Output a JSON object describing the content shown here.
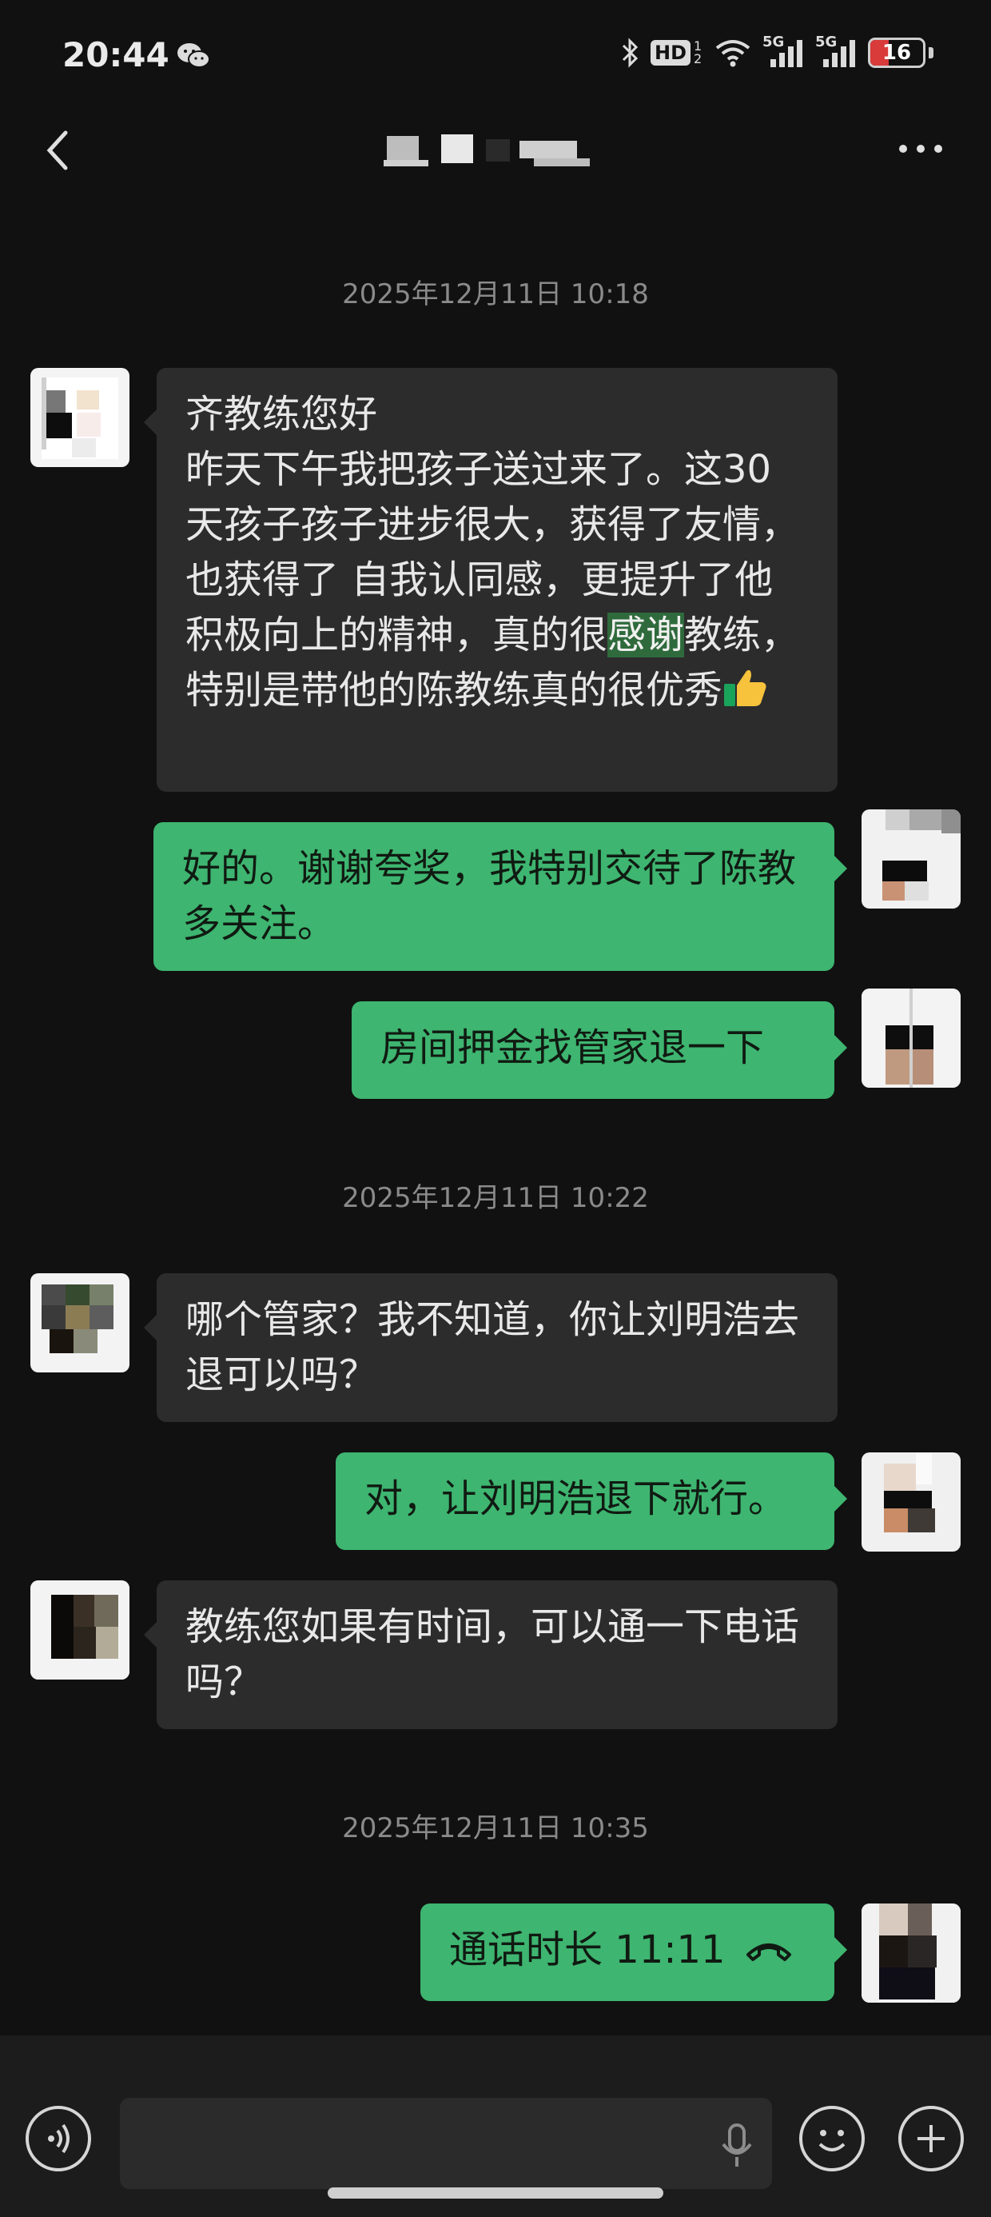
{
  "status_bar": {
    "time": "20:44",
    "hd_label": "HD",
    "hd_sub": "1 2",
    "network_1": "5G",
    "network_2": "5G",
    "battery": "16",
    "battery_level": 0.16,
    "battery_color": "#d93a3a",
    "icons": [
      "wechat-icon",
      "bluetooth-icon",
      "hd-icon",
      "wifi-icon",
      "signal-5g-icon",
      "signal-5g-icon",
      "battery-icon"
    ]
  },
  "header": {
    "back_icon": "chevron-left-icon",
    "title": "",
    "more_icon": "more-dots-icon"
  },
  "timestamps": [
    "2025年12月11日 10:18",
    "2025年12月11日 10:22",
    "2025年12月11日 10:35"
  ],
  "messages": [
    {
      "side": "in",
      "text_before": "齐教练您好\n昨天下午我把孩子送过来了。这30天孩子孩子进步很大，获得了友情，也获得了 自我认同感，更提升了他积极向上的精神，真的很",
      "highlight": "感谢",
      "text_after": "教练，特别是带他的陈教练真的很优秀",
      "emoji": "thumbs-up-icon"
    },
    {
      "side": "out",
      "text": "好的。谢谢夸奖，我特别交待了陈教多关注。"
    },
    {
      "side": "out",
      "text": "房间押金找管家退一下"
    },
    {
      "side": "in",
      "text": "哪个管家？我不知道，你让刘明浩去退可以吗？"
    },
    {
      "side": "out",
      "text": "对，让刘明浩退下就行。"
    },
    {
      "side": "in",
      "text": "教练您如果有时间，可以通一下电话吗？"
    },
    {
      "side": "out",
      "text": "通话时长 11:11",
      "icon": "hangup-phone-icon"
    }
  ],
  "input_bar": {
    "voice_icon": "voice-toggle-icon",
    "mic_icon": "mic-icon",
    "emoji_icon": "emoji-icon",
    "plus_icon": "plus-icon"
  },
  "colors": {
    "background": "#111111",
    "bubble_in": "#2c2c2c",
    "bubble_out": "#3eb570",
    "timestamp": "#8a8a8a"
  }
}
